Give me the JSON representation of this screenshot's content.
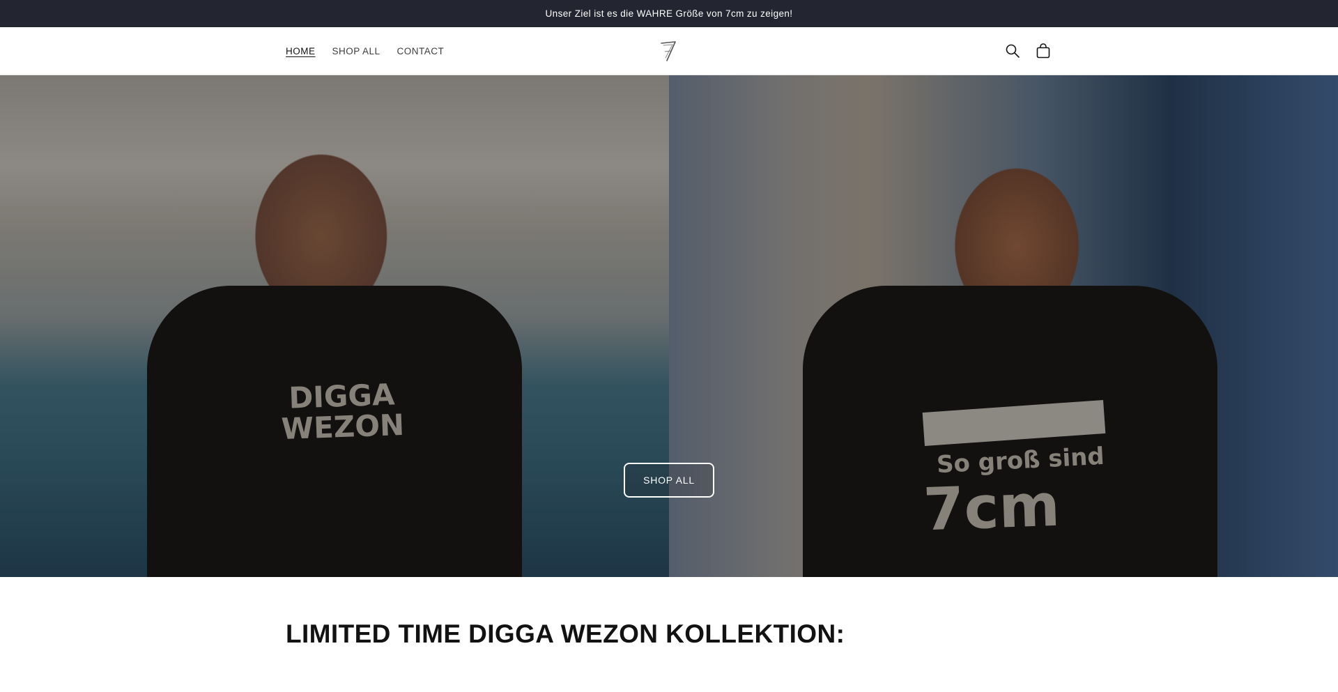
{
  "announcement": {
    "text": "Unser Ziel ist es die WAHRE Größe von 7cm zu zeigen!"
  },
  "header": {
    "nav": [
      {
        "label": "HOME",
        "active": true
      },
      {
        "label": "SHOP ALL",
        "active": false
      },
      {
        "label": "CONTACT",
        "active": false
      }
    ],
    "logo_icon": "seven-logo-icon",
    "icons": [
      "search-icon",
      "cart-icon"
    ]
  },
  "hero": {
    "left_shirt_text": "DIGGA\nWEZON",
    "right_shirt_line1": "So groß sind",
    "right_shirt_line2": "7cm",
    "button_label": "SHOP ALL"
  },
  "collection": {
    "title": "LIMITED TIME DIGGA WEZON KOLLEKTION:"
  },
  "colors": {
    "announcement_bg": "#232631",
    "text": "#121212",
    "button_border": "#ffffff"
  }
}
